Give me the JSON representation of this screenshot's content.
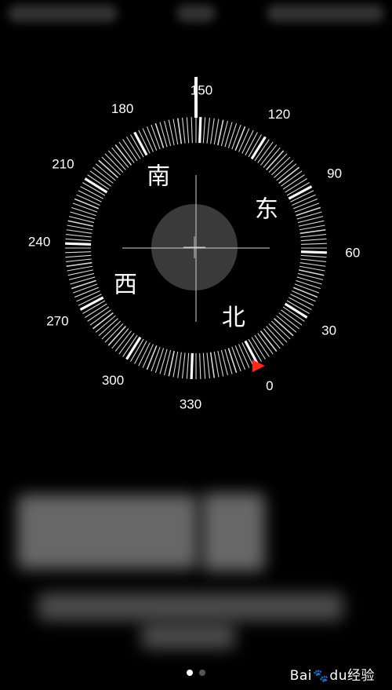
{
  "compass": {
    "degree_labels": [
      "0",
      "30",
      "60",
      "90",
      "120",
      "150",
      "180",
      "210",
      "240",
      "270",
      "300",
      "330"
    ],
    "cardinals": {
      "north": "北",
      "east": "东",
      "south": "南",
      "west": "西"
    },
    "heading_deg": 152,
    "target_marker_deg": 0,
    "colors": {
      "accent": "#ff2a1a",
      "ring": "#ffffff",
      "background": "#000000",
      "level_disc": "#3a3a3a"
    }
  },
  "page_indicator": {
    "count": 2,
    "active": 0
  },
  "watermark": {
    "brand_a": "Bai",
    "brand_b": "du",
    "suffix": "经验",
    "icon": "paw-icon"
  }
}
